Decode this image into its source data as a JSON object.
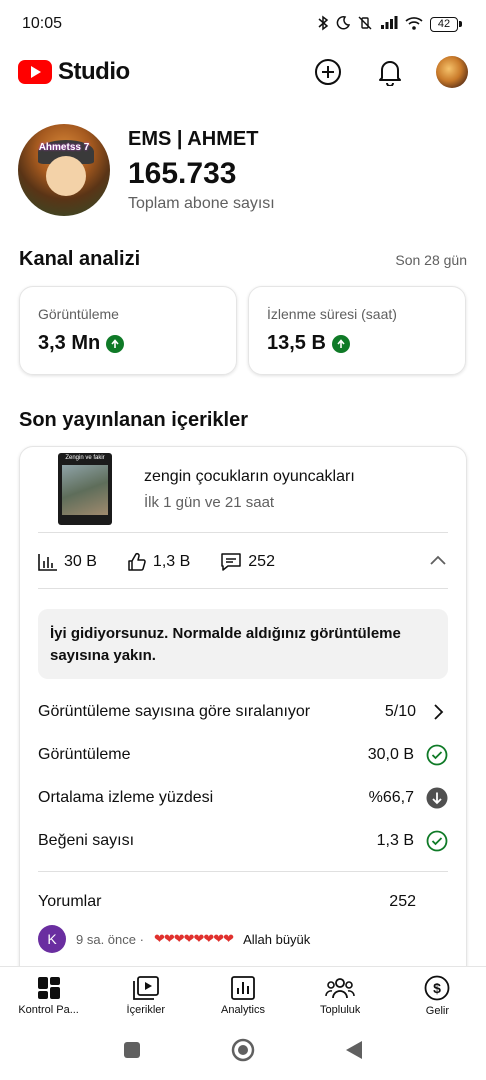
{
  "status_bar": {
    "time": "10:05",
    "battery": "42"
  },
  "app": {
    "logo_text": "Studio"
  },
  "channel": {
    "name": "EMS | AHMET",
    "subscribers": "165.733",
    "subscribers_label": "Toplam abone sayısı",
    "avatar_tag": "Ahmetss 7"
  },
  "analytics": {
    "title": "Kanal analizi",
    "period": "Son 28 gün",
    "cards": [
      {
        "label": "Görüntüleme",
        "value": "3,3 Mn"
      },
      {
        "label": "İzlenme süresi (saat)",
        "value": "13,5 B"
      }
    ]
  },
  "recent": {
    "title": "Son yayınlanan içerikler",
    "video": {
      "thumb_text": "Zengin ve fakir",
      "title": "zengin çocukların oyuncakları",
      "subtitle": "İlk 1 gün ve 21 saat"
    },
    "metrics": {
      "views": "30 B",
      "likes": "1,3 B",
      "comments": "252"
    },
    "insight": "İyi gidiyorsunuz. Normalde aldığınız görüntüleme sayısına yakın.",
    "rows": [
      {
        "label": "Görüntüleme sayısına göre sıralanıyor",
        "value": "5/10",
        "icon": "chevron-right-icon"
      },
      {
        "label": "Görüntüleme",
        "value": "30,0 B",
        "icon": "check-circle-icon"
      },
      {
        "label": "Ortalama izleme yüzdesi",
        "value": "%66,7",
        "icon": "arrow-down-circle-icon"
      },
      {
        "label": "Beğeni sayısı",
        "value": "1,3 B",
        "icon": "check-circle-icon"
      }
    ],
    "comments_label": "Yorumlar",
    "comments_count": "252",
    "comment": {
      "avatar": "K",
      "time": "9 sa. önce ·",
      "hearts": "❤❤❤❤❤❤❤❤",
      "text": "Allah büyük"
    }
  },
  "bottom_nav": [
    {
      "label": "Kontrol Pa...",
      "icon": "dashboard-icon"
    },
    {
      "label": "İçerikler",
      "icon": "content-icon"
    },
    {
      "label": "Analytics",
      "icon": "analytics-icon"
    },
    {
      "label": "Topluluk",
      "icon": "community-icon"
    },
    {
      "label": "Gelir",
      "icon": "earn-icon"
    }
  ],
  "colors": {
    "brand_red": "#ff0000",
    "up_green": "#0f7a27",
    "check_green": "#0f7a27"
  }
}
